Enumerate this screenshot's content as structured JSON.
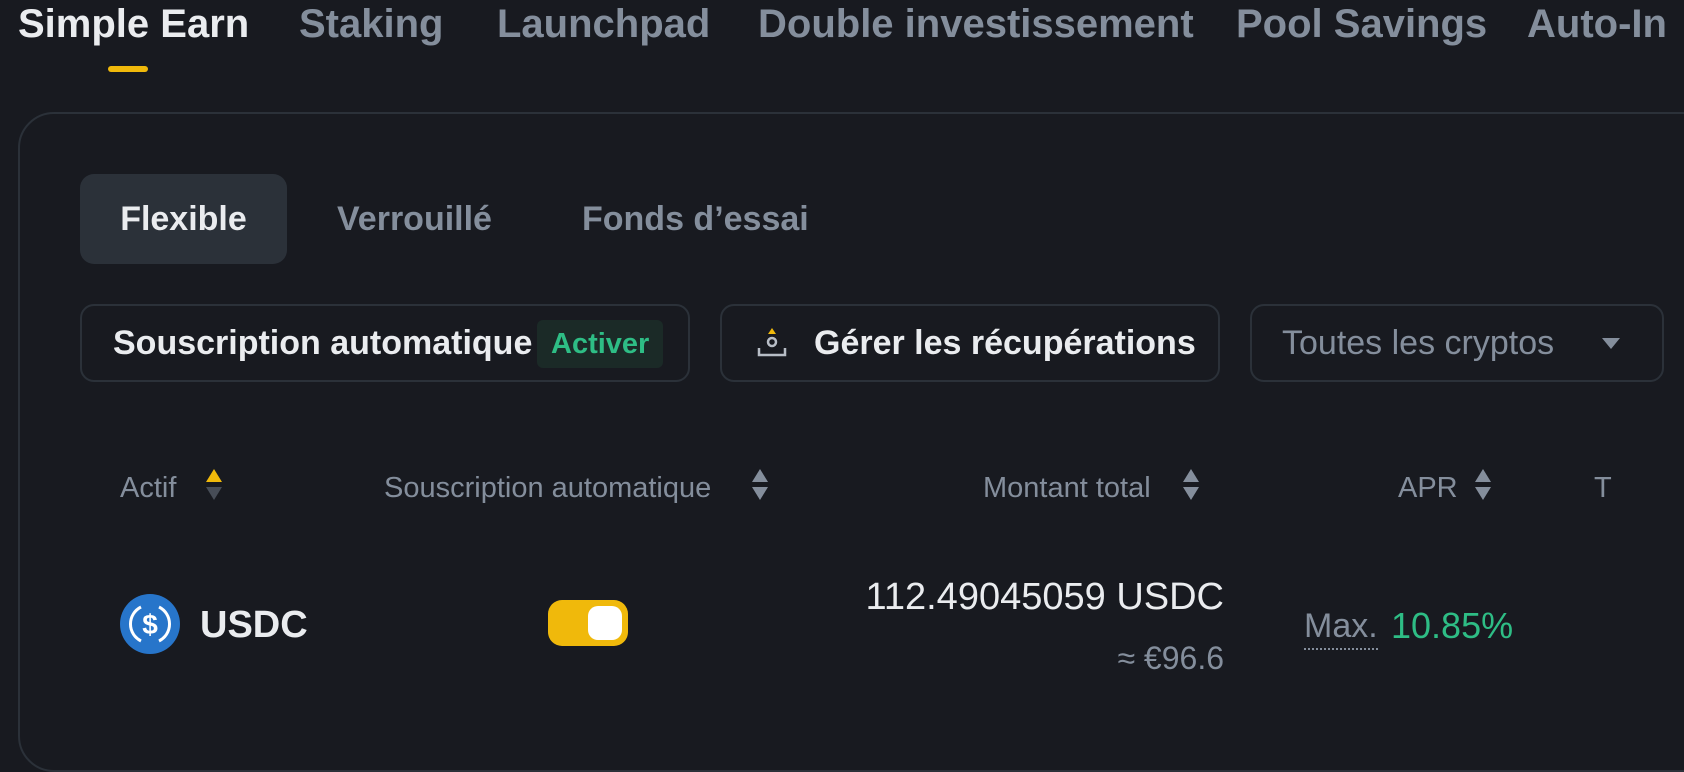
{
  "top_tabs": {
    "simple_earn": "Simple Earn",
    "staking": "Staking",
    "launchpad": "Launchpad",
    "dual": "Double investissement",
    "pool": "Pool Savings",
    "auto_invest": "Auto-In"
  },
  "sub_tabs": {
    "flexible": "Flexible",
    "locked": "Verrouillé",
    "trial": "Fonds d’essai"
  },
  "actions": {
    "auto_subscribe_label": "Souscription automatique",
    "auto_subscribe_badge": "Activer",
    "manage_redemptions": "Gérer les récupérations",
    "crypto_filter": "Toutes les cryptos"
  },
  "table": {
    "headers": {
      "asset": "Actif",
      "auto_subscribe": "Souscription automatique",
      "total_amount": "Montant total",
      "apr": "APR",
      "next": "T"
    },
    "rows": [
      {
        "asset": "USDC",
        "auto_subscribe_on": true,
        "amount": "112.49045059 USDC",
        "amount_eur": "≈ €96.6",
        "apr_prefix": "Max.",
        "apr": "10.85%"
      }
    ]
  },
  "colors": {
    "background": "#181A20",
    "accent": "#F0B90B",
    "positive": "#2EBD85",
    "usdc_blue": "#2775CA"
  },
  "icons": [
    "redeem-icon",
    "caret-down-icon",
    "sort-icon",
    "usdc-coin-icon"
  ]
}
